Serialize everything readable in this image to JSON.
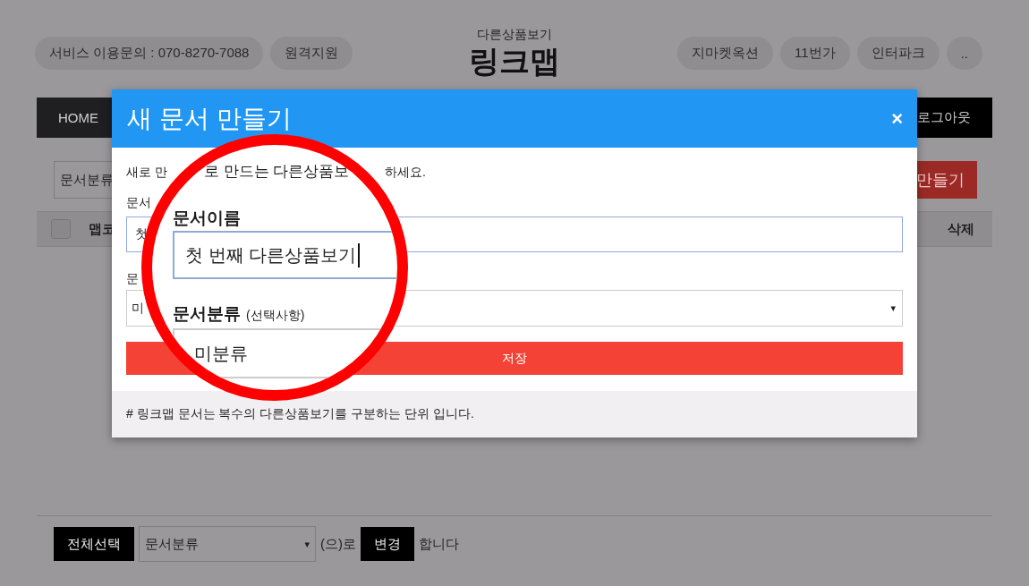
{
  "header": {
    "contact_pill": "서비스 이용문의 : 070-8270-7088",
    "remote_pill": "원격지원",
    "subtitle": "다른상품보기",
    "logo": "링크맵",
    "shop_links": [
      "지마켓옥션",
      "11번가",
      "인터파크",
      ".."
    ]
  },
  "nav": {
    "home": "HOME",
    "logout": "로그아웃"
  },
  "toolbar": {
    "category_select": "문서분류",
    "create_button": "만들기"
  },
  "table": {
    "columns": [
      "맵코",
      "삭제"
    ],
    "select_all_checked": false
  },
  "modal": {
    "title": "새 문서 만들기",
    "close": "×",
    "intro_start": "새로 만",
    "intro_end": "하세요.",
    "name_label": "문서",
    "name_value": "첫",
    "category_label": "문",
    "category_value": "미",
    "category_arrow": "▾",
    "save_button": "저장",
    "note": "# 링크맵 문서는 복수의 다른상품보기를 구분하는 단위 입니다."
  },
  "magnifier": {
    "intro": "로 만드는 다른상품보",
    "name_label": "문서이름",
    "name_value": "첫 번째 다른상품보기",
    "category_label": "문서분류",
    "category_hint": "(선택사항)",
    "category_value": "미분류"
  },
  "bulk_bar": {
    "select_all_button": "전체선택",
    "category_select": "문서분류",
    "arrow": "▾",
    "to_text": "(으)로",
    "change_button": "변경",
    "suffix": "합니다"
  }
}
